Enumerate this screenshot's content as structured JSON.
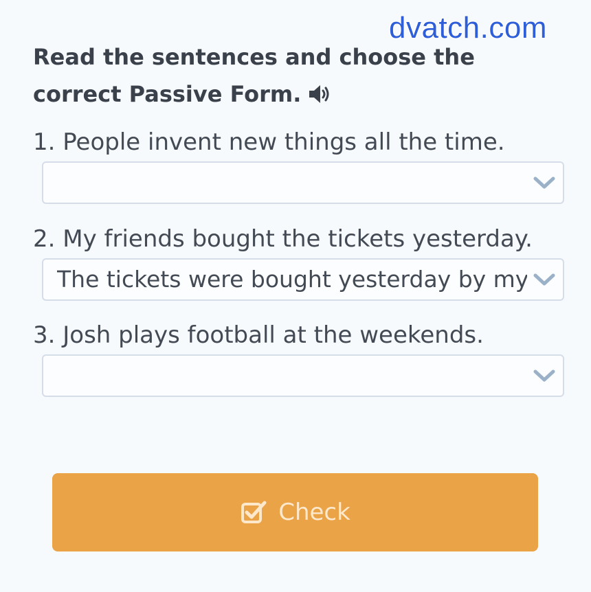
{
  "watermark": "dvatch.com",
  "instructions": {
    "title": "Read the sentences and choose the correct Passive Form."
  },
  "icons": {
    "speaker": "speaker-icon",
    "dropdown": "chevron-down-icon",
    "check": "checkbox-check-icon"
  },
  "questions": [
    {
      "text": "1. People invent new things all the time.",
      "selected": ""
    },
    {
      "text": "2. My friends bought the tickets yesterday.",
      "selected": "The tickets were bought yesterday by my friends."
    },
    {
      "text": "3. Josh plays football at the weekends.",
      "selected": ""
    }
  ],
  "check_button": {
    "label": "Check"
  },
  "colors": {
    "accent": "#eaa347",
    "watermark": "#2f5fd8",
    "chevron": "#9bb1c7",
    "border": "#d5dde8"
  }
}
